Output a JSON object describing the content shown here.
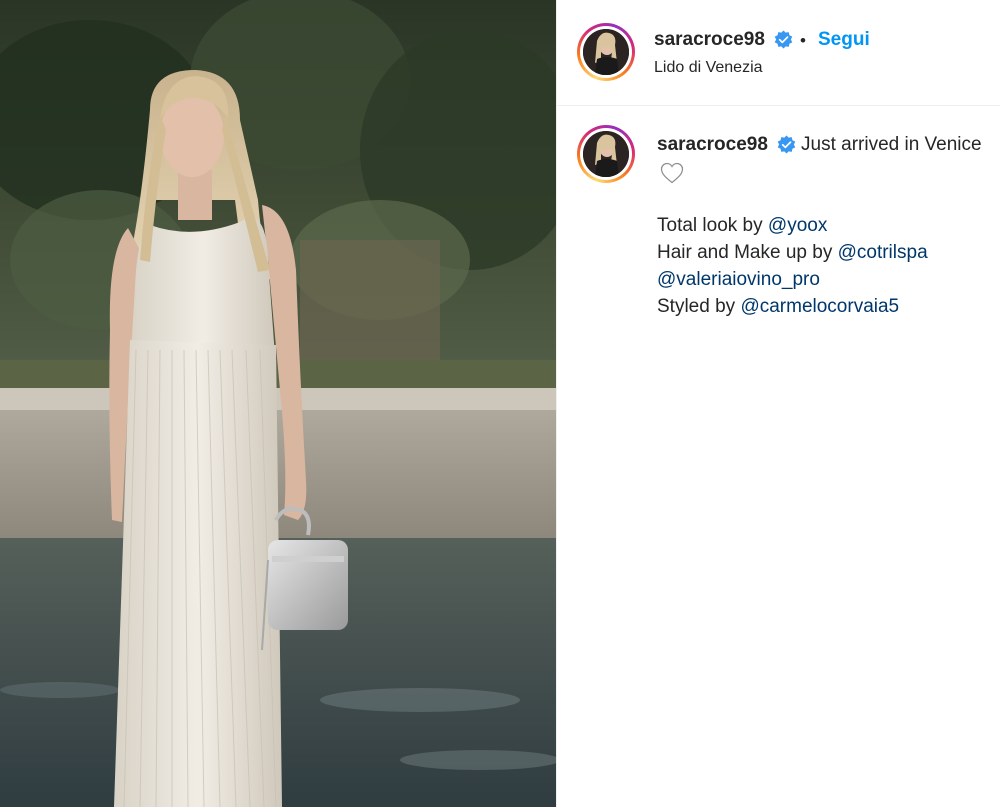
{
  "header": {
    "username": "saracroce98",
    "separator": "•",
    "follow_label": "Segui",
    "location": "Lido di Venezia"
  },
  "caption": {
    "username": "saracroce98",
    "text": "Just arrived in Venice",
    "lines": [
      {
        "prefix": "Total look by ",
        "mention": "@yoox"
      },
      {
        "prefix": "Hair and Make up by ",
        "mention": "@cotrilspa"
      },
      {
        "prefix": "",
        "mention": "@valeriaiovino_pro"
      },
      {
        "prefix": "Styled by ",
        "mention": "@carmelocorvaia5"
      }
    ]
  },
  "colors": {
    "follow": "#0095f6",
    "mention": "#00376b",
    "verified": "#3897f0",
    "text": "#262626"
  },
  "icons": {
    "verified": "verified-badge-icon",
    "like": "heart-outline-icon"
  }
}
